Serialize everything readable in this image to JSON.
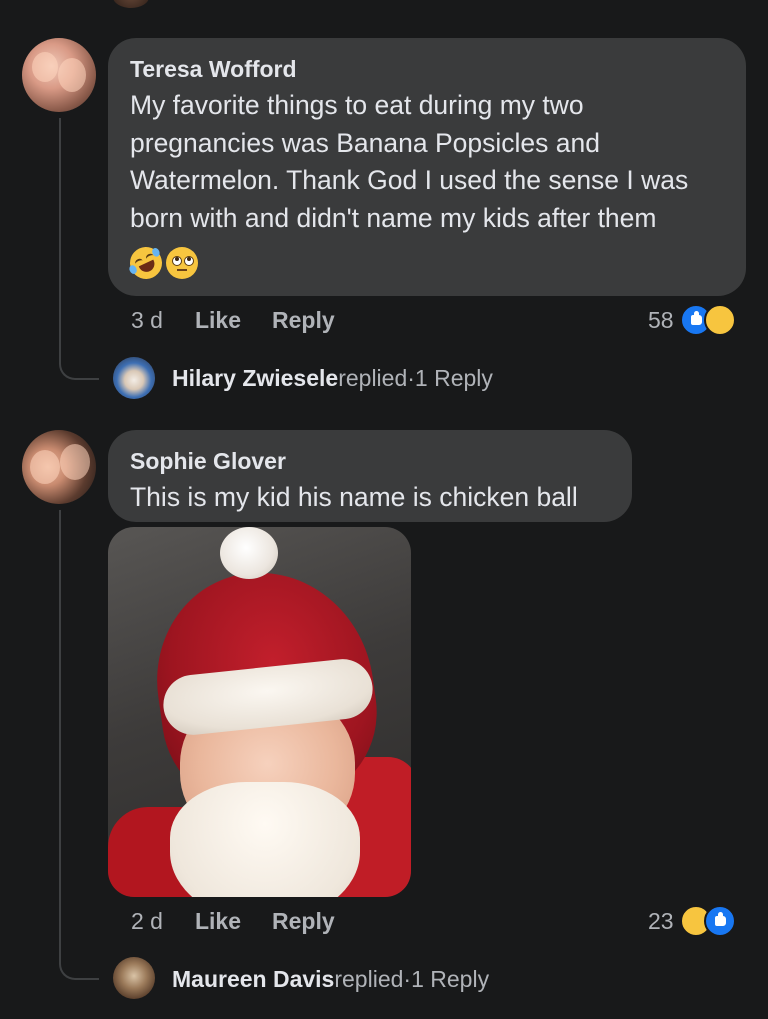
{
  "comments": [
    {
      "author": "Teresa Wofford",
      "text": "My favorite things to eat during my two pregnancies was Banana Popsicles and Watermelon. Thank God I used the sense I was born with and didn't name my kids after them",
      "emojis": [
        "rolling-on-floor-laughing-emoji",
        "eye-roll-emoji"
      ],
      "time": "3 d",
      "like_label": "Like",
      "reply_label": "Reply",
      "reaction_count": "58",
      "reactions": [
        "like",
        "haha"
      ],
      "reply_summary": {
        "name": "Hilary Zwiesele",
        "replied": "replied",
        "separator": "·",
        "count_label": "1 Reply"
      }
    },
    {
      "author": "Sophie Glover",
      "text": "This is my kid his name is chicken ball",
      "attachment": "photo-baby-santa-hat",
      "time": "2 d",
      "like_label": "Like",
      "reply_label": "Reply",
      "reaction_count": "23",
      "reactions": [
        "haha",
        "like"
      ],
      "reply_summary": {
        "name": "Maureen Davis",
        "replied": "replied",
        "separator": "·",
        "count_label": "1 Reply"
      }
    }
  ],
  "colors": {
    "background": "#18191a",
    "bubble": "#3a3b3c",
    "primary_text": "#e4e6eb",
    "secondary_text": "#b0b3b8",
    "like_blue": "#1877f2",
    "haha_yellow": "#f7c53f"
  }
}
